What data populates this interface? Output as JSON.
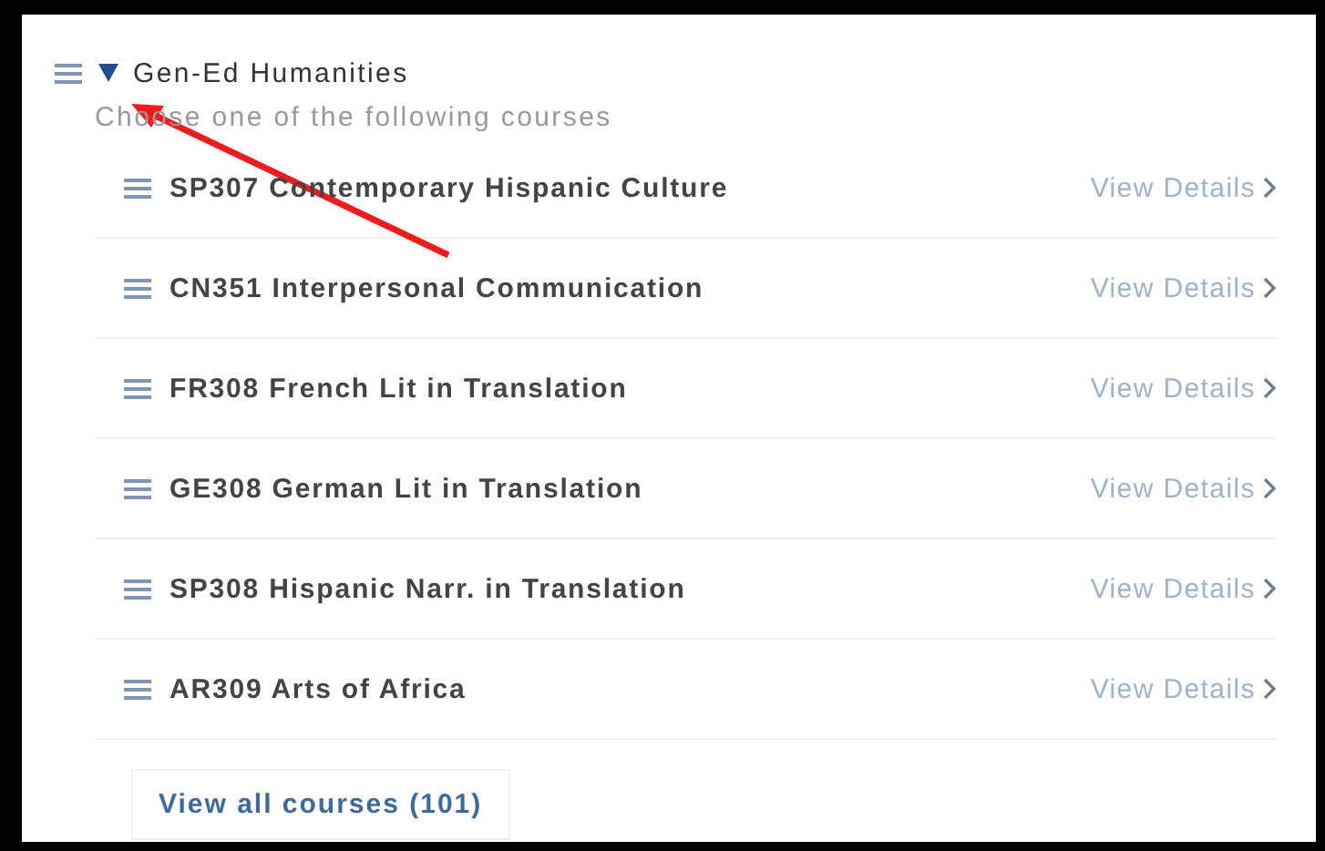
{
  "group": {
    "title": "Gen-Ed Humanities",
    "expanded": true,
    "subtitle": "Choose one of the following courses"
  },
  "courses": [
    {
      "name": "SP307 Contemporary Hispanic Culture",
      "link": "View Details"
    },
    {
      "name": "CN351 Interpersonal Communication",
      "link": "View Details"
    },
    {
      "name": "FR308 French Lit in Translation",
      "link": "View Details"
    },
    {
      "name": "GE308 German Lit in Translation",
      "link": "View Details"
    },
    {
      "name": "SP308 Hispanic Narr. in Translation",
      "link": "View Details"
    },
    {
      "name": "AR309 Arts of Africa",
      "link": "View Details"
    }
  ],
  "view_all_button": "View all courses (101)"
}
